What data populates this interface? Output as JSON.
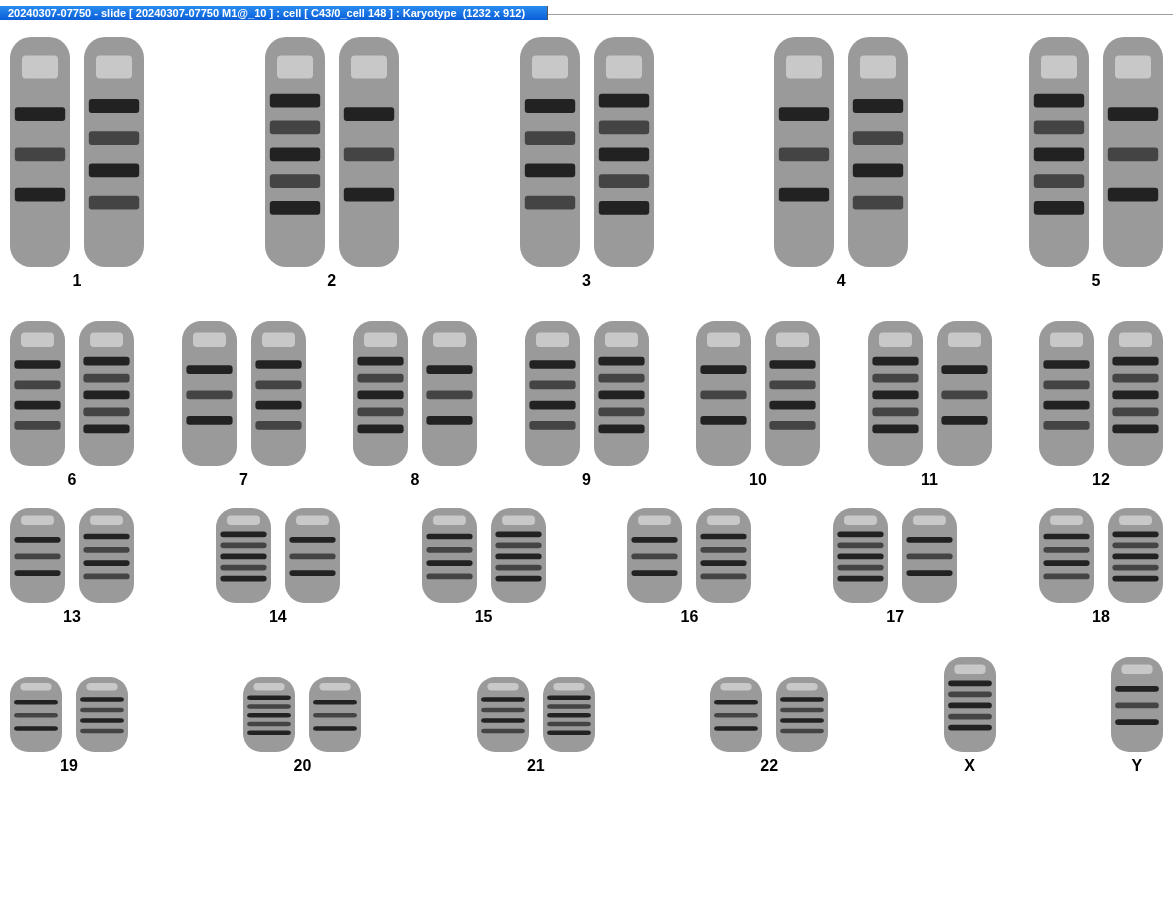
{
  "window": {
    "title": "20240307-07750 - slide [ 20240307-07750 M1@_10 ] : cell [ C43/0_cell 148 ] : Karyotype  (1232 x 912)"
  },
  "karyotype": {
    "rows": [
      {
        "groups": [
          {
            "label": "1",
            "kind": "pair"
          },
          {
            "label": "2",
            "kind": "pair"
          },
          {
            "label": "3",
            "kind": "pair"
          },
          {
            "label": "4",
            "kind": "pair"
          },
          {
            "label": "5",
            "kind": "pair"
          }
        ]
      },
      {
        "groups": [
          {
            "label": "6",
            "kind": "pair"
          },
          {
            "label": "7",
            "kind": "pair"
          },
          {
            "label": "8",
            "kind": "pair"
          },
          {
            "label": "9",
            "kind": "pair"
          },
          {
            "label": "10",
            "kind": "pair"
          },
          {
            "label": "11",
            "kind": "pair"
          },
          {
            "label": "12",
            "kind": "pair"
          }
        ]
      },
      {
        "groups": [
          {
            "label": "13",
            "kind": "pair"
          },
          {
            "label": "14",
            "kind": "pair"
          },
          {
            "label": "15",
            "kind": "pair"
          },
          {
            "label": "16",
            "kind": "pair"
          },
          {
            "label": "17",
            "kind": "pair"
          },
          {
            "label": "18",
            "kind": "pair"
          }
        ]
      },
      {
        "groups": [
          {
            "label": "19",
            "kind": "pair"
          },
          {
            "label": "20",
            "kind": "pair"
          },
          {
            "label": "21",
            "kind": "pair"
          },
          {
            "label": "22",
            "kind": "pair"
          },
          {
            "label": "X",
            "kind": "single"
          },
          {
            "label": "Y",
            "kind": "single"
          }
        ]
      }
    ]
  }
}
